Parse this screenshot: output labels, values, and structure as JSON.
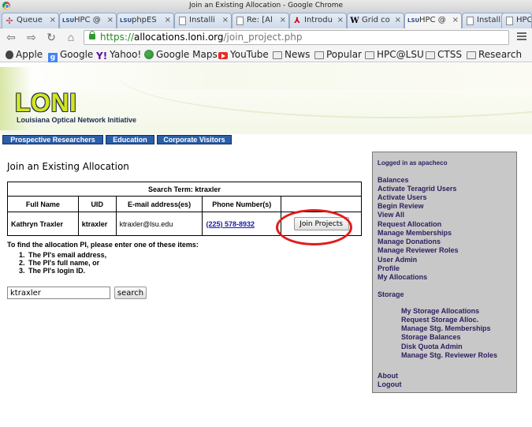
{
  "window": {
    "title": "Join an Existing Allocation - Google Chrome"
  },
  "tabs": [
    {
      "label": "Queue",
      "icon": "queue-favicon"
    },
    {
      "label": "HPC @",
      "icon": "lsu-favicon"
    },
    {
      "label": "phpES",
      "icon": "lsu-favicon"
    },
    {
      "label": "Installi",
      "icon": "doc-favicon"
    },
    {
      "label": "Re: [Al",
      "icon": "doc-favicon"
    },
    {
      "label": "Introdu",
      "icon": "pdf-favicon"
    },
    {
      "label": "Grid co",
      "icon": "wikipedia-favicon"
    },
    {
      "label": "HPC @",
      "icon": "lsu-favicon"
    },
    {
      "label": "Installi",
      "icon": "doc-favicon"
    },
    {
      "label": "HPC",
      "icon": "doc-favicon"
    }
  ],
  "address_bar": {
    "scheme": "https://",
    "host": "allocations.loni.org",
    "path": "/join_project.php"
  },
  "bookmarks": [
    {
      "label": "Apple",
      "icon": "apple-icon"
    },
    {
      "label": "Google",
      "icon": "google-icon"
    },
    {
      "label": "Yahoo!",
      "icon": "yahoo-icon"
    },
    {
      "label": "Google Maps",
      "icon": "maps-icon"
    },
    {
      "label": "YouTube",
      "icon": "youtube-icon"
    },
    {
      "label": "News",
      "icon": "folder-icon"
    },
    {
      "label": "Popular",
      "icon": "folder-icon"
    },
    {
      "label": "HPC@LSU",
      "icon": "folder-icon"
    },
    {
      "label": "CTSS",
      "icon": "folder-icon"
    },
    {
      "label": "Research",
      "icon": "folder-icon"
    }
  ],
  "site": {
    "logo": "LONI",
    "logo_subtitle": "Louisiana Optical Network Initiative",
    "nav": [
      "Prospective Researchers",
      "Education",
      "Corporate Visitors"
    ]
  },
  "main": {
    "title": "Join an Existing Allocation",
    "search_term_label": "Search Term: ktraxler",
    "columns": [
      "Full Name",
      "UID",
      "E-mail address(es)",
      "Phone Number(s)",
      ""
    ],
    "row": {
      "full_name": "Kathryn Traxler",
      "uid": "ktraxler",
      "email": "ktraxler@lsu.edu",
      "phone": "(225) 578-8932",
      "action": "Join Projects"
    },
    "instructions": "To find the allocation PI, please enter one of these items:",
    "items": [
      "The PI's email address,",
      "The PI's full name, or",
      "The PI's login ID."
    ],
    "search_value": "ktraxler",
    "search_button": "search"
  },
  "sidebar": {
    "logged_in": "Logged in as apacheco",
    "links": [
      "Balances",
      "Activate Teragrid Users",
      "Activate Users",
      "Begin Review",
      "View All",
      "Request Allocation",
      "Manage Memberships",
      "Manage Donations",
      "Manage Reviewer Roles",
      "User Admin",
      "Profile",
      "My Allocations"
    ],
    "storage_heading": "Storage",
    "storage_links": [
      "My Storage Allocations",
      "Request Storage Alloc.",
      "Manage Stg. Memberships",
      "Storage Balances",
      "Disk Quota Admin",
      "Manage Stg. Reviewer Roles"
    ],
    "footer_links": [
      "About",
      "Logout"
    ]
  }
}
